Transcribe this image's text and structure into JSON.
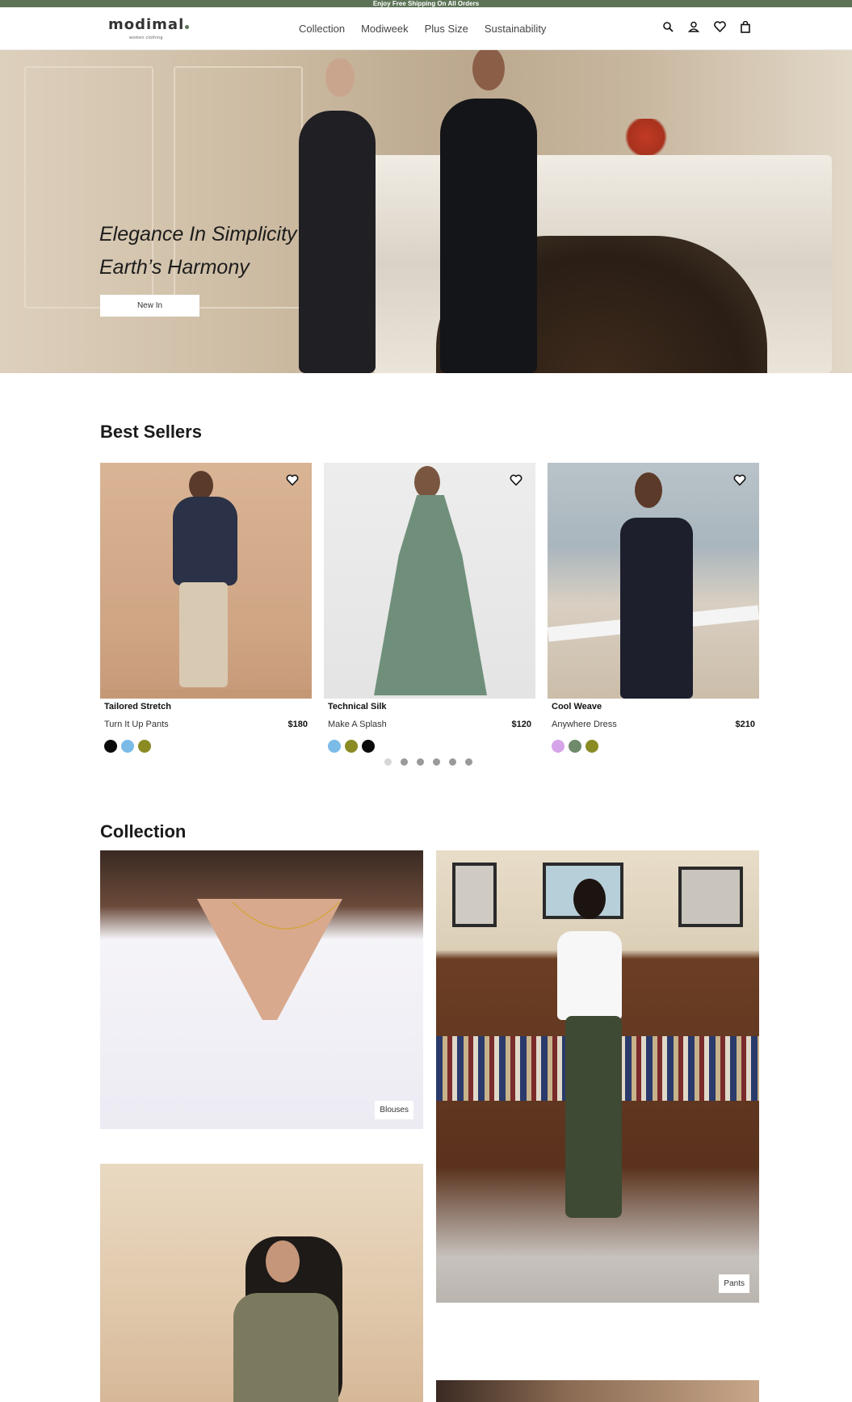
{
  "announcement": "Enjoy Free Shipping On All Orders",
  "brand": {
    "name": "modimal",
    "tagline": "women clothing",
    "accent": "#5c7356"
  },
  "nav": {
    "items": [
      "Collection",
      "Modiweek",
      "Plus Size",
      "Sustainability"
    ]
  },
  "header_icons": [
    "search-icon",
    "account-icon",
    "wishlist-icon",
    "bag-icon"
  ],
  "hero": {
    "line1": "Elegance In Simplicity",
    "line2": "Earth’s Harmony",
    "button": "New In"
  },
  "best_sellers": {
    "title": "Best Sellers",
    "products": [
      {
        "name": "Tailored Stretch",
        "subtitle": "Turn It Up Pants",
        "price": "$180",
        "swatches": [
          "#0b0b0b",
          "#7bbbe8",
          "#8b8b24"
        ]
      },
      {
        "name": "Technical Silk",
        "subtitle": "Make A Splash",
        "price": "$120",
        "swatches": [
          "#7bbbe8",
          "#8b8b24",
          "#0b0b0b"
        ]
      },
      {
        "name": "Cool Weave",
        "subtitle": "Anywhere Dress",
        "price": "$210",
        "swatches": [
          "#d6a4e8",
          "#6f8a6a",
          "#8b8b24"
        ]
      }
    ],
    "carousel_dots": 6,
    "active_dot": 0
  },
  "collection": {
    "title": "Collection",
    "tiles": [
      "Blouses",
      "Pants"
    ]
  }
}
